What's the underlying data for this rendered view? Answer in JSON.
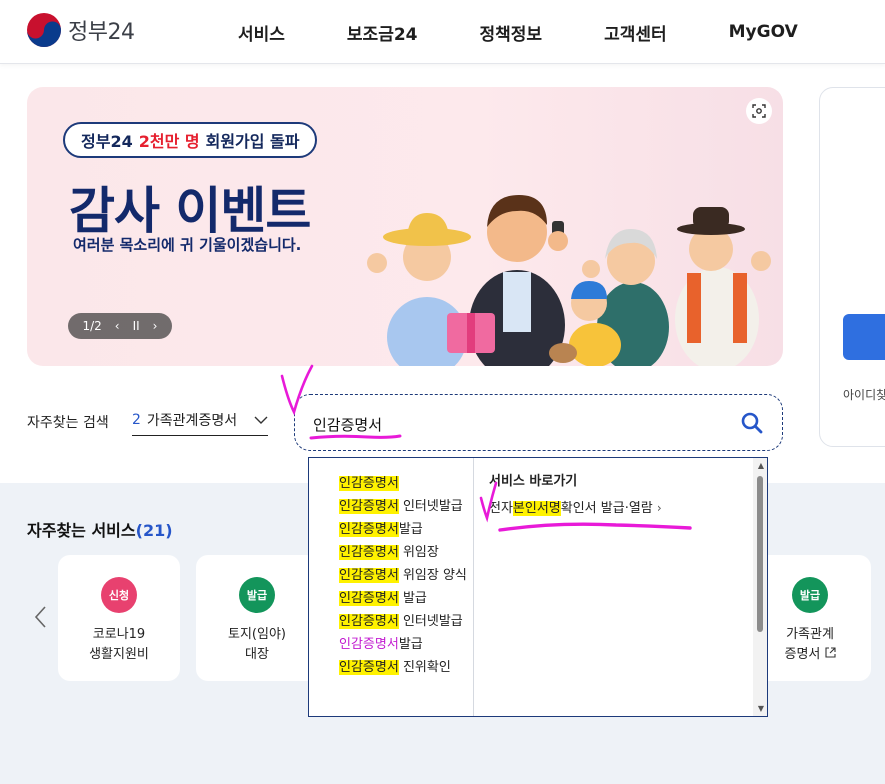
{
  "header": {
    "logo_text": "정부24",
    "nav": [
      "서비스",
      "보조금24",
      "정책정보",
      "고객센터",
      "MyGOV"
    ]
  },
  "banner": {
    "pill_prefix": "정부24",
    "pill_highlight": "2천만 명",
    "pill_suffix": "회원가입 돌파",
    "title": "감사 이벤트",
    "subtitle": "여러분 목소리에 귀 기울이겠습니다.",
    "pager": "1/2",
    "pager_prev": "‹",
    "pager_pause": "II",
    "pager_next": "›"
  },
  "login": {
    "partial_text": "아이디찾"
  },
  "frequent_search": {
    "label": "자주찾는 검색",
    "number": "2",
    "value": "가족관계증명서"
  },
  "search": {
    "value": "인감증명서"
  },
  "autocomplete": {
    "suggestions": [
      {
        "hl": "인감증명서",
        "rest": ""
      },
      {
        "hl": "인감증명서",
        "rest": " 인터넷발급"
      },
      {
        "hl": "인감증명서",
        "rest": "발급"
      },
      {
        "hl": "인감증명서",
        "rest": " 위임장"
      },
      {
        "hl": "인감증명서",
        "rest": " 위임장 양식"
      },
      {
        "hl": "인감증명서",
        "rest": " 발급"
      },
      {
        "hl": "인감증명서",
        "rest": " 인터넷발급",
        "extra_pink": "인감증명서",
        "extra_rest": "발급"
      },
      {
        "hl": "인감증명서",
        "rest": " 진위확인"
      }
    ],
    "shortcut_title": "서비스 바로가기",
    "shortcut_prefix": "전자",
    "shortcut_hl": "본인서명",
    "shortcut_suffix": "확인서 발급·열람",
    "shortcut_arrow": "›"
  },
  "services": {
    "title": "자주찾는 서비스",
    "count_open": "(",
    "count": "21",
    "count_close": ")",
    "items": [
      {
        "badge": "신청",
        "badge_color": "#e8416f",
        "name1": "코로나19",
        "name2": "생활지원비"
      },
      {
        "badge": "발급",
        "badge_color": "#13955b",
        "name1": "토지(임야)",
        "name2": "대장"
      },
      {
        "badge": "발급",
        "badge_color": "#13955b",
        "name1": "가족관계",
        "name2": "증명서"
      }
    ]
  },
  "colors": {
    "brand_navy": "#13296b",
    "accent_red": "#e6202f",
    "link_blue": "#2656c9",
    "highlight": "#fff200",
    "annotation_magenta": "#e81ad8"
  }
}
